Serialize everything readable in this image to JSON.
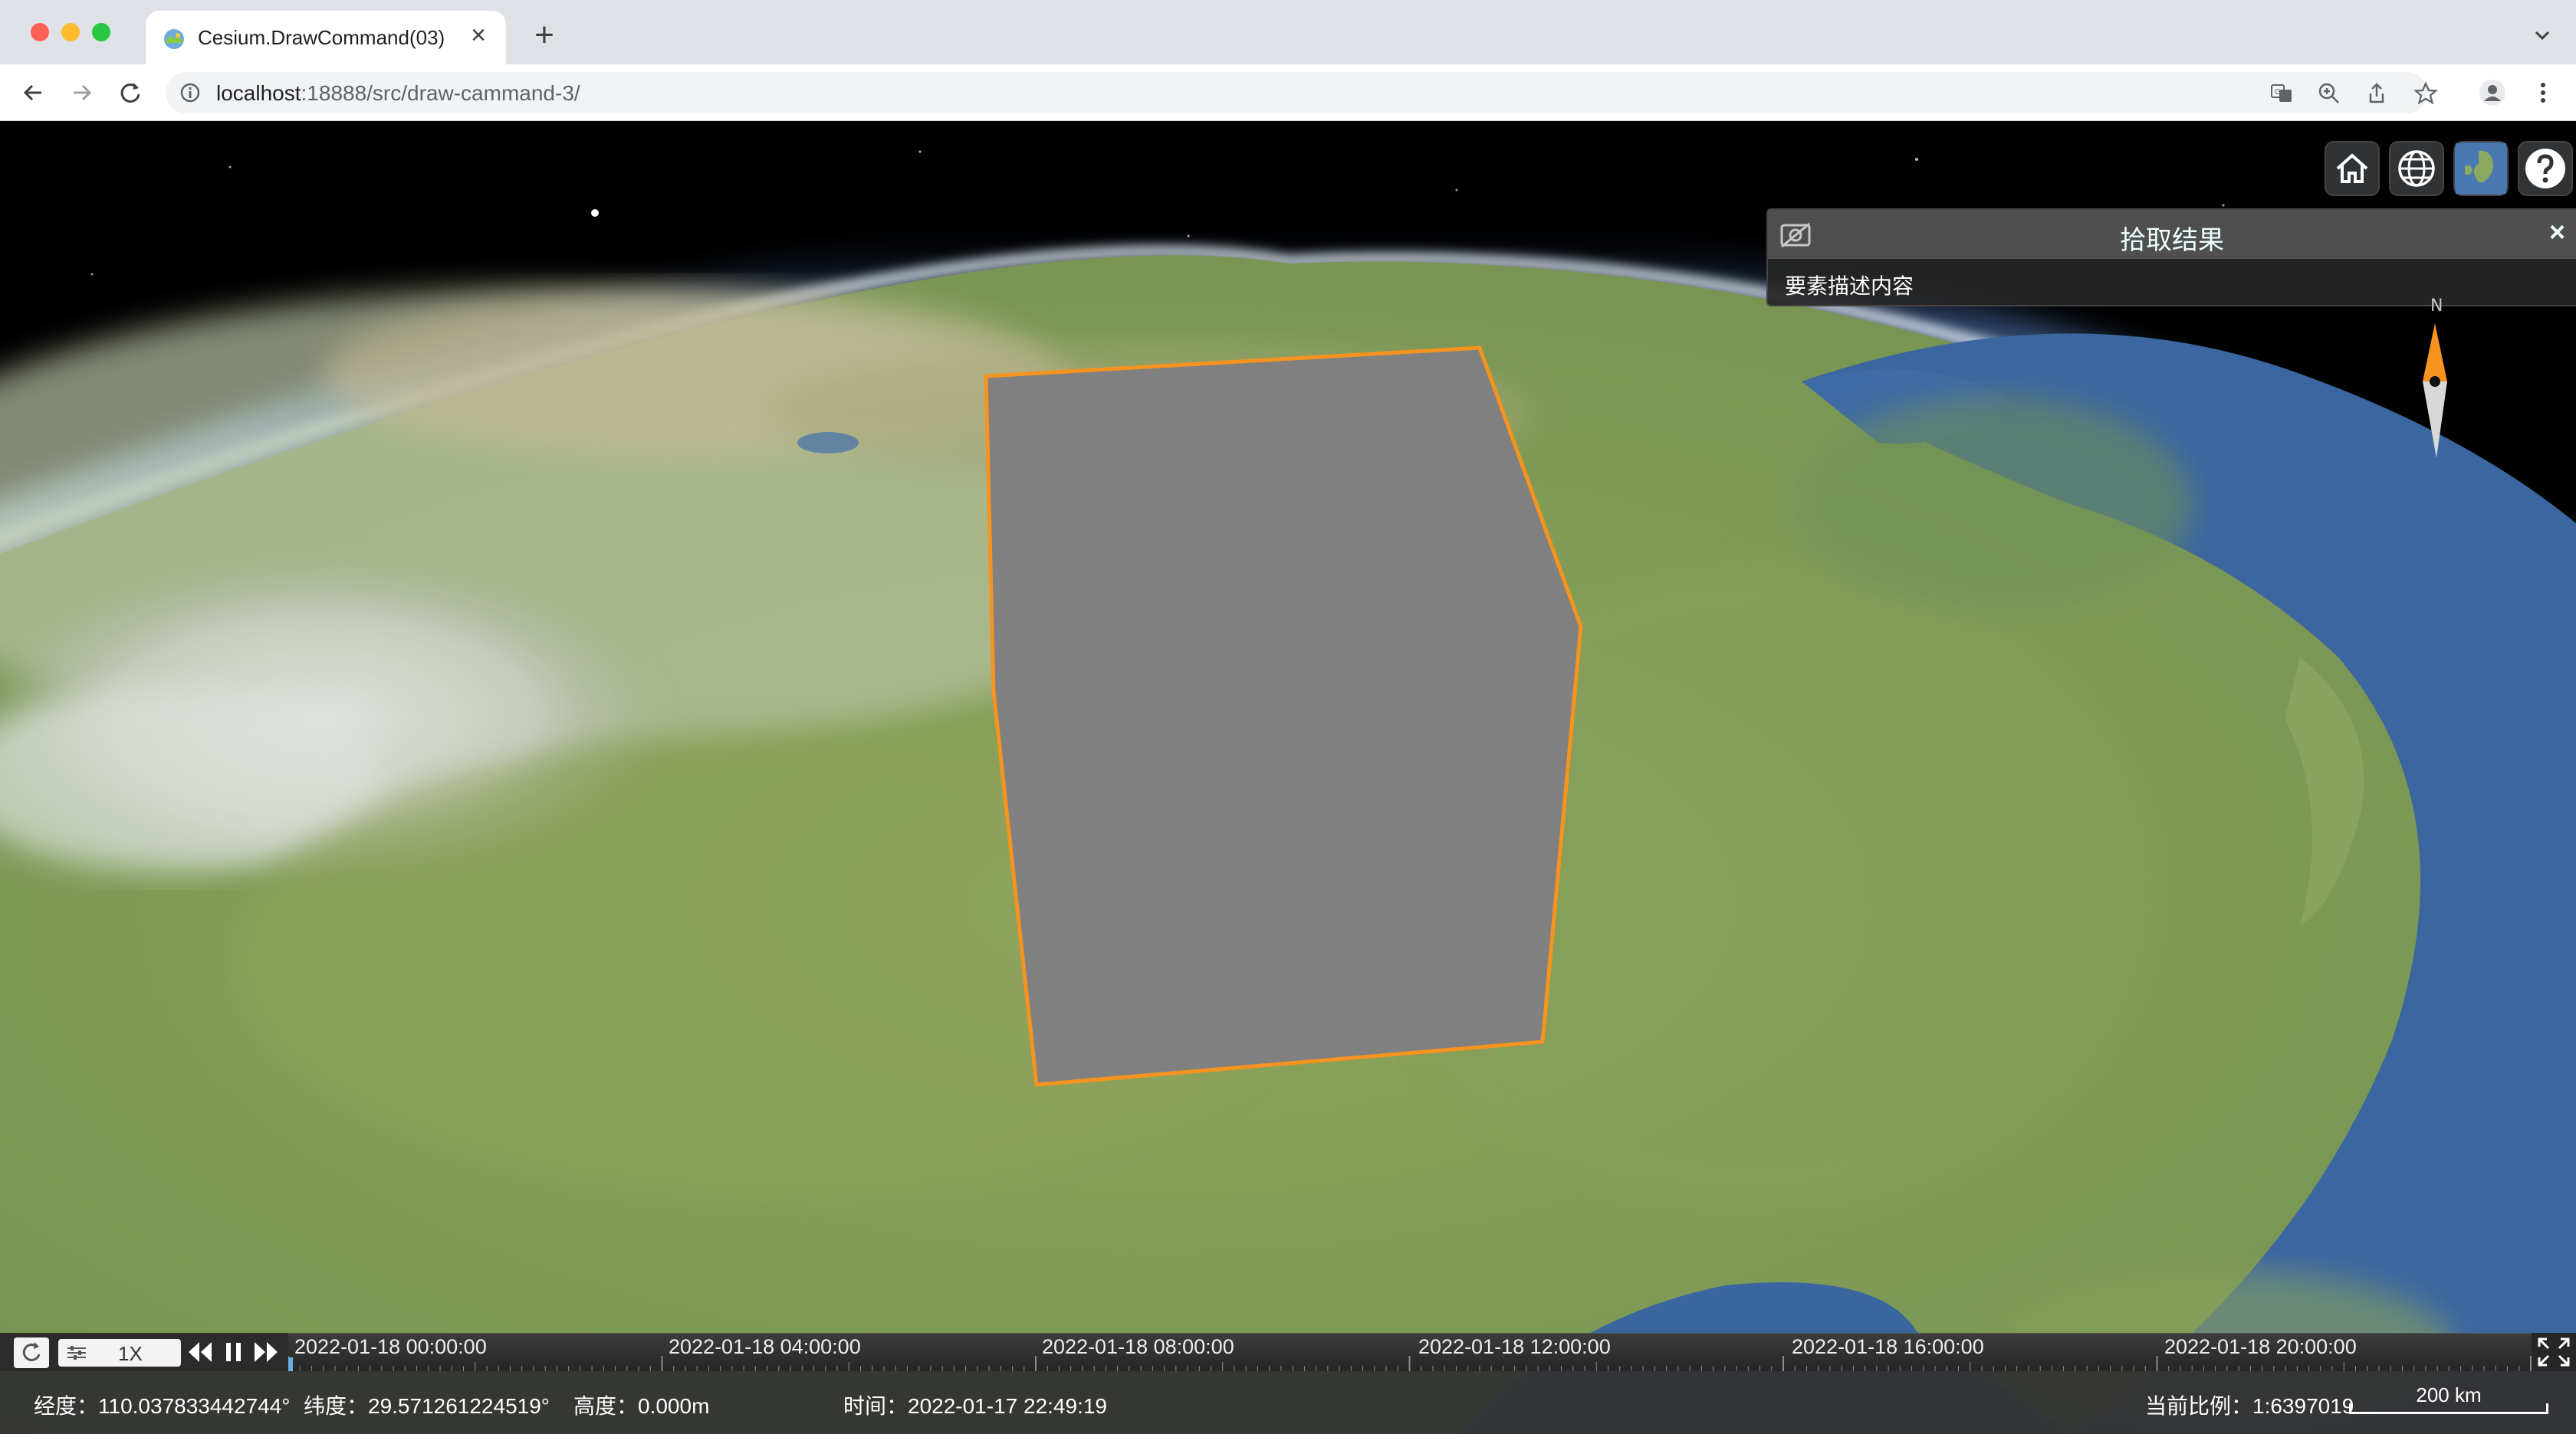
{
  "browser": {
    "tab_title": "Cesium.DrawCommand(03)",
    "url_host": "localhost",
    "url_rest": ":18888/src/draw-cammand-3/"
  },
  "viewer": {
    "toolbar_buttons": [
      "home-icon",
      "globe-icon",
      "imagery-layer-icon",
      "help-icon"
    ],
    "infobox": {
      "title": "拾取结果",
      "close": "×",
      "description": "要素描述内容"
    },
    "compass": {
      "north_label": "N"
    },
    "animation": {
      "speed": "1X"
    },
    "timeline": {
      "labels": [
        "2022-01-18 00:00:00",
        "2022-01-18 04:00:00",
        "2022-01-18 08:00:00",
        "2022-01-18 12:00:00",
        "2022-01-18 16:00:00",
        "2022-01-18 20:00:00"
      ]
    },
    "status": {
      "longitude": "经度：110.037833442744°",
      "latitude": "纬度：29.571261224519°",
      "height": "高度：0.000m",
      "time": "时间：2022-01-17 22:49:19",
      "scale": "当前比例：1:6397019",
      "scale_bar": "200 km"
    },
    "colors": {
      "outline": "#f7931e",
      "box_fill": "#808080",
      "ocean": "#3a66a0",
      "land": "#7f9a55"
    }
  }
}
